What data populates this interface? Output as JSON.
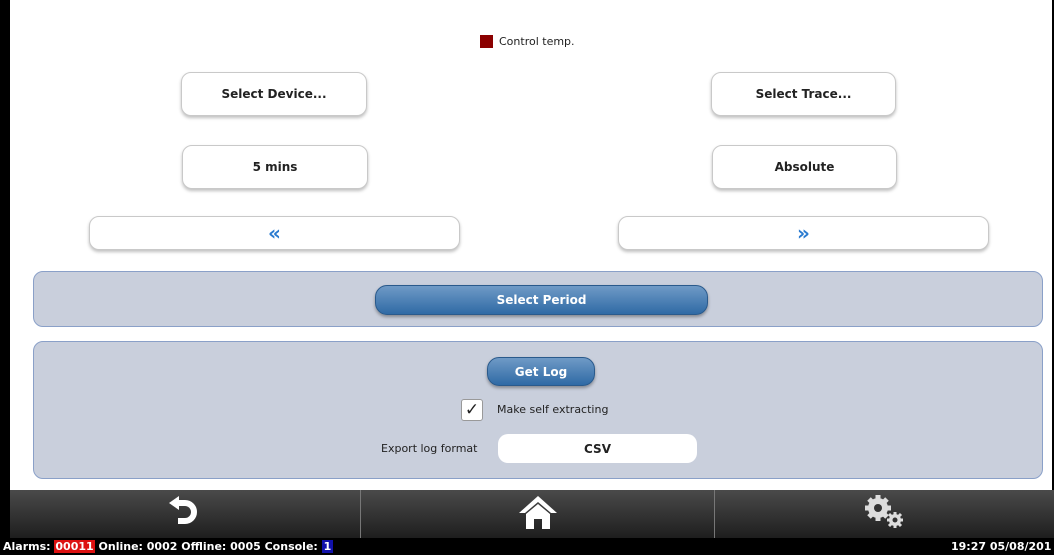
{
  "legend": {
    "label": "Control temp.",
    "color": "#8b0000"
  },
  "buttons": {
    "select_device": "Select Device...",
    "select_trace": "Select Trace...",
    "duration": "5 mins",
    "mode": "Absolute",
    "prev": "«",
    "next": "»"
  },
  "period_panel": {
    "select_period": "Select Period"
  },
  "log_panel": {
    "get_log": "Get Log",
    "self_extract_label": "Make self extracting",
    "self_extract_checked": true,
    "check_mark": "✓",
    "export_format_label": "Export log format",
    "export_format_value": "CSV"
  },
  "nav": {
    "back": "back-icon",
    "home": "home-icon",
    "settings": "gear-icon"
  },
  "status": {
    "alarms_label": "Alarms:",
    "alarms_value": "00011",
    "online": "Online: 0002",
    "offline": "Offline: 0005",
    "console_label": "Console:",
    "console_value": "1",
    "datetime": "19:27 05/08/201"
  }
}
